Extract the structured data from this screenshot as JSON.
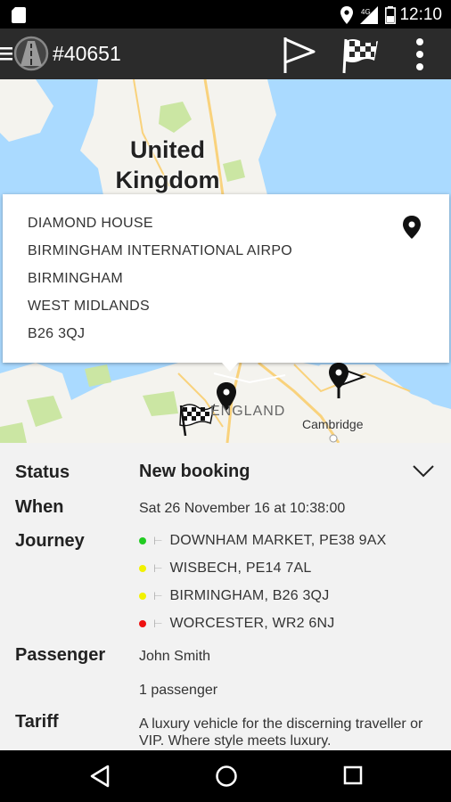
{
  "status_bar": {
    "time": "12:10",
    "icons": [
      "sd-card-icon",
      "location-icon",
      "signal-icon",
      "battery-icon"
    ]
  },
  "app_bar": {
    "title": "#40651",
    "actions": [
      "flag-icon",
      "checkered-flag-icon",
      "overflow-menu-icon"
    ]
  },
  "map": {
    "label_country": "United Kingdom",
    "label_region": "ENGLAND",
    "label_city": "Cambridge",
    "colors": {
      "water": "#aadaff",
      "land": "#f4f3ee",
      "park": "#cbe6a3",
      "road": "#f9d27c"
    }
  },
  "popup": {
    "lines": [
      "DIAMOND HOUSE",
      "BIRMINGHAM INTERNATIONAL AIRPO",
      "BIRMINGHAM",
      "WEST MIDLANDS",
      "B26 3QJ"
    ]
  },
  "details": {
    "status_label": "Status",
    "status_value": "New booking",
    "when_label": "When",
    "when_value": "Sat 26 November 16 at 10:38:00",
    "journey_label": "Journey",
    "journey": [
      {
        "color": "#22cc22",
        "text": "DOWNHAM MARKET, PE38 9AX"
      },
      {
        "color": "#f2f200",
        "text": "WISBECH, PE14 7AL"
      },
      {
        "color": "#f2f200",
        "text": "BIRMINGHAM, B26 3QJ"
      },
      {
        "color": "#ee1111",
        "text": "WORCESTER, WR2 6NJ"
      }
    ],
    "passenger_label": "Passenger",
    "passenger_name": "John Smith",
    "passenger_count": "1 passenger",
    "tariff_label": "Tariff",
    "tariff_text": "A luxury vehicle for the discerning traveller or VIP. Where style meets luxury."
  }
}
